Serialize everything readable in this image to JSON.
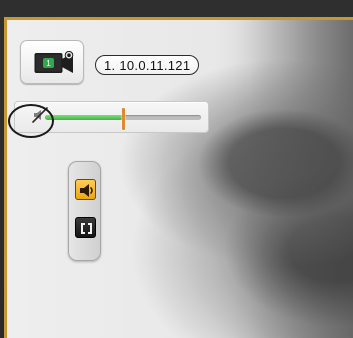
{
  "camera": {
    "ip_address": "1. 10.0.11.121",
    "icon": "video-camera-icon",
    "channel_badge": "1"
  },
  "audio": {
    "mute_icon": "speaker-muted-icon",
    "volume_fraction": 0.5
  },
  "side_toolbar": {
    "buttons": [
      {
        "icon": "speaker-audio-icon",
        "state": "active"
      },
      {
        "icon": "fullscreen-icon",
        "state": "inactive"
      }
    ]
  },
  "colors": {
    "frame_border": "#c9972f",
    "volume_fill": "#3eb83e",
    "volume_thumb": "#e08a2f",
    "active_button": "#f0a60c"
  }
}
